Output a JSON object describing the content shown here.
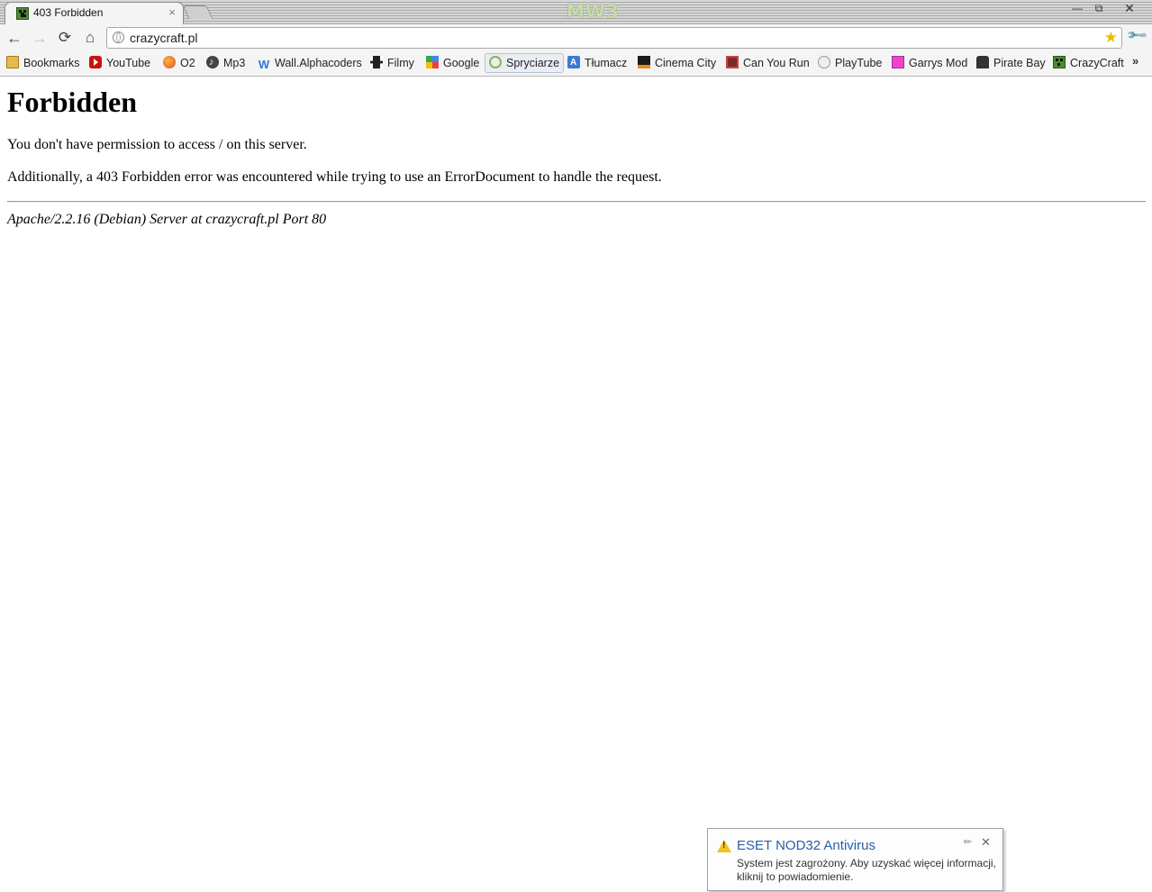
{
  "tab": {
    "title": "403 Forbidden",
    "close_glyph": "×"
  },
  "window": {
    "brand": "MW3",
    "minimize": "—",
    "maximize": "⧉",
    "close": "✕"
  },
  "toolbar": {
    "back": "←",
    "forward": "→",
    "reload": "⟳",
    "home": "⌂",
    "url": "crazycraft.pl",
    "star": "★",
    "wrench": "🔧"
  },
  "bookmarks": {
    "items": [
      {
        "label": "Bookmarks",
        "icon": "folder-icon"
      },
      {
        "label": "YouTube",
        "icon": "youtube-icon"
      },
      {
        "label": "O2",
        "icon": "balloon-icon"
      },
      {
        "label": "Mp3",
        "icon": "music-note-icon"
      },
      {
        "label": "Wall.Alphacoders",
        "icon": "w-letter-icon"
      },
      {
        "label": "Filmy",
        "icon": "film-strip-icon"
      },
      {
        "label": "Google",
        "icon": "google-icon"
      },
      {
        "label": "Spryciarze",
        "icon": "spryciarze-icon"
      },
      {
        "label": "Tłumacz",
        "icon": "translate-icon"
      },
      {
        "label": "Cinema City",
        "icon": "cinema-icon"
      },
      {
        "label": "Can You Run",
        "icon": "can-you-run-icon"
      },
      {
        "label": "PlayTube",
        "icon": "globe-icon"
      },
      {
        "label": "Garrys Mod",
        "icon": "garrys-mod-icon"
      },
      {
        "label": "Pirate Bay",
        "icon": "pirate-ship-icon"
      },
      {
        "label": "CrazyCraft",
        "icon": "creeper-icon"
      }
    ],
    "overflow": "»"
  },
  "page": {
    "heading": "Forbidden",
    "line1": "You don't have permission to access / on this server.",
    "line2": "Additionally, a 403 Forbidden error was encountered while trying to use an ErrorDocument to handle the request.",
    "signature": "Apache/2.2.16 (Debian) Server at crazycraft.pl Port 80"
  },
  "notification": {
    "title": "ESET NOD32 Antivirus",
    "body": "System jest zagrożony. Aby uzyskać więcej informacji, kliknij to powiadomienie.",
    "pin": "✎",
    "close": "✕"
  }
}
